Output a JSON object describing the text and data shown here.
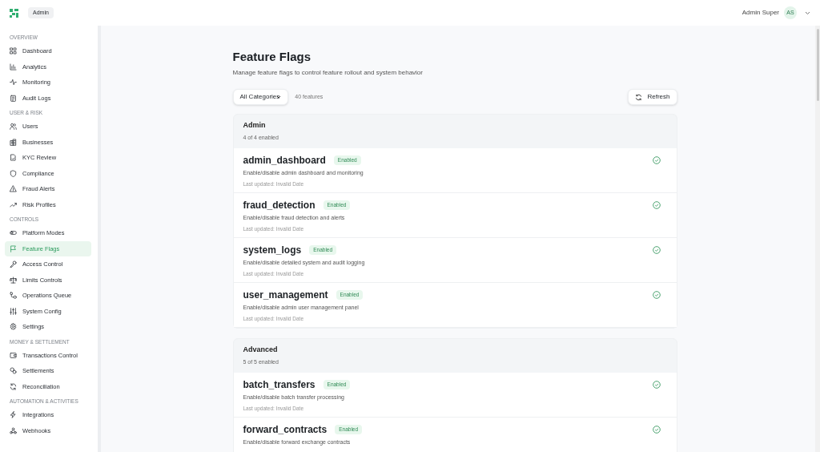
{
  "header": {
    "app_badge": "Admin",
    "user_name": "Admin Super",
    "user_initials": "AS"
  },
  "sidebar": {
    "sections": [
      {
        "title": "OVERVIEW",
        "items": [
          {
            "label": "Dashboard",
            "selected": false
          },
          {
            "label": "Analytics",
            "selected": false
          },
          {
            "label": "Monitoring",
            "selected": false
          },
          {
            "label": "Audit Logs",
            "selected": false
          }
        ]
      },
      {
        "title": "USER & RISK",
        "items": [
          {
            "label": "Users",
            "selected": false
          },
          {
            "label": "Businesses",
            "selected": false
          },
          {
            "label": "KYC Review",
            "selected": false
          },
          {
            "label": "Compliance",
            "selected": false
          },
          {
            "label": "Fraud Alerts",
            "selected": false
          },
          {
            "label": "Risk Profiles",
            "selected": false
          }
        ]
      },
      {
        "title": "CONTROLS",
        "items": [
          {
            "label": "Platform Modes",
            "selected": false
          },
          {
            "label": "Feature Flags",
            "selected": true
          },
          {
            "label": "Access Control",
            "selected": false
          },
          {
            "label": "Limits Controls",
            "selected": false
          },
          {
            "label": "Operations Queue",
            "selected": false
          },
          {
            "label": "System Config",
            "selected": false
          },
          {
            "label": "Settings",
            "selected": false
          }
        ]
      },
      {
        "title": "MONEY & SETTLEMENT",
        "items": [
          {
            "label": "Transactions Control",
            "selected": false
          },
          {
            "label": "Settlements",
            "selected": false
          },
          {
            "label": "Reconciliation",
            "selected": false
          }
        ]
      },
      {
        "title": "AUTOMATION & ACTIVITIES",
        "items": [
          {
            "label": "Integrations",
            "selected": false
          },
          {
            "label": "Webhooks",
            "selected": false
          }
        ]
      }
    ]
  },
  "page": {
    "title": "Feature Flags",
    "subtitle": "Manage feature flags to control feature rollout and system behavior",
    "category_select": "All Categories",
    "feature_count": "40 features",
    "refresh_button": "Refresh"
  },
  "groups": [
    {
      "name": "Admin",
      "summary": "4 of 4 enabled",
      "flags": [
        {
          "name": "admin_dashboard",
          "status": "Enabled",
          "enabled": true,
          "description": "Enable/disable admin dashboard and monitoring",
          "updated": "Last updated: Invalid Date"
        },
        {
          "name": "fraud_detection",
          "status": "Enabled",
          "enabled": true,
          "description": "Enable/disable fraud detection and alerts",
          "updated": "Last updated: Invalid Date"
        },
        {
          "name": "system_logs",
          "status": "Enabled",
          "enabled": true,
          "description": "Enable/disable detailed system and audit logging",
          "updated": "Last updated: Invalid Date"
        },
        {
          "name": "user_management",
          "status": "Enabled",
          "enabled": true,
          "description": "Enable/disable admin user management panel",
          "updated": "Last updated: Invalid Date"
        }
      ]
    },
    {
      "name": "Advanced",
      "summary": "5 of 5 enabled",
      "flags": [
        {
          "name": "batch_transfers",
          "status": "Enabled",
          "enabled": true,
          "description": "Enable/disable batch transfer processing",
          "updated": "Last updated: Invalid Date"
        },
        {
          "name": "forward_contracts",
          "status": "Enabled",
          "enabled": true,
          "description": "Enable/disable forward exchange contracts"
        }
      ]
    }
  ]
}
